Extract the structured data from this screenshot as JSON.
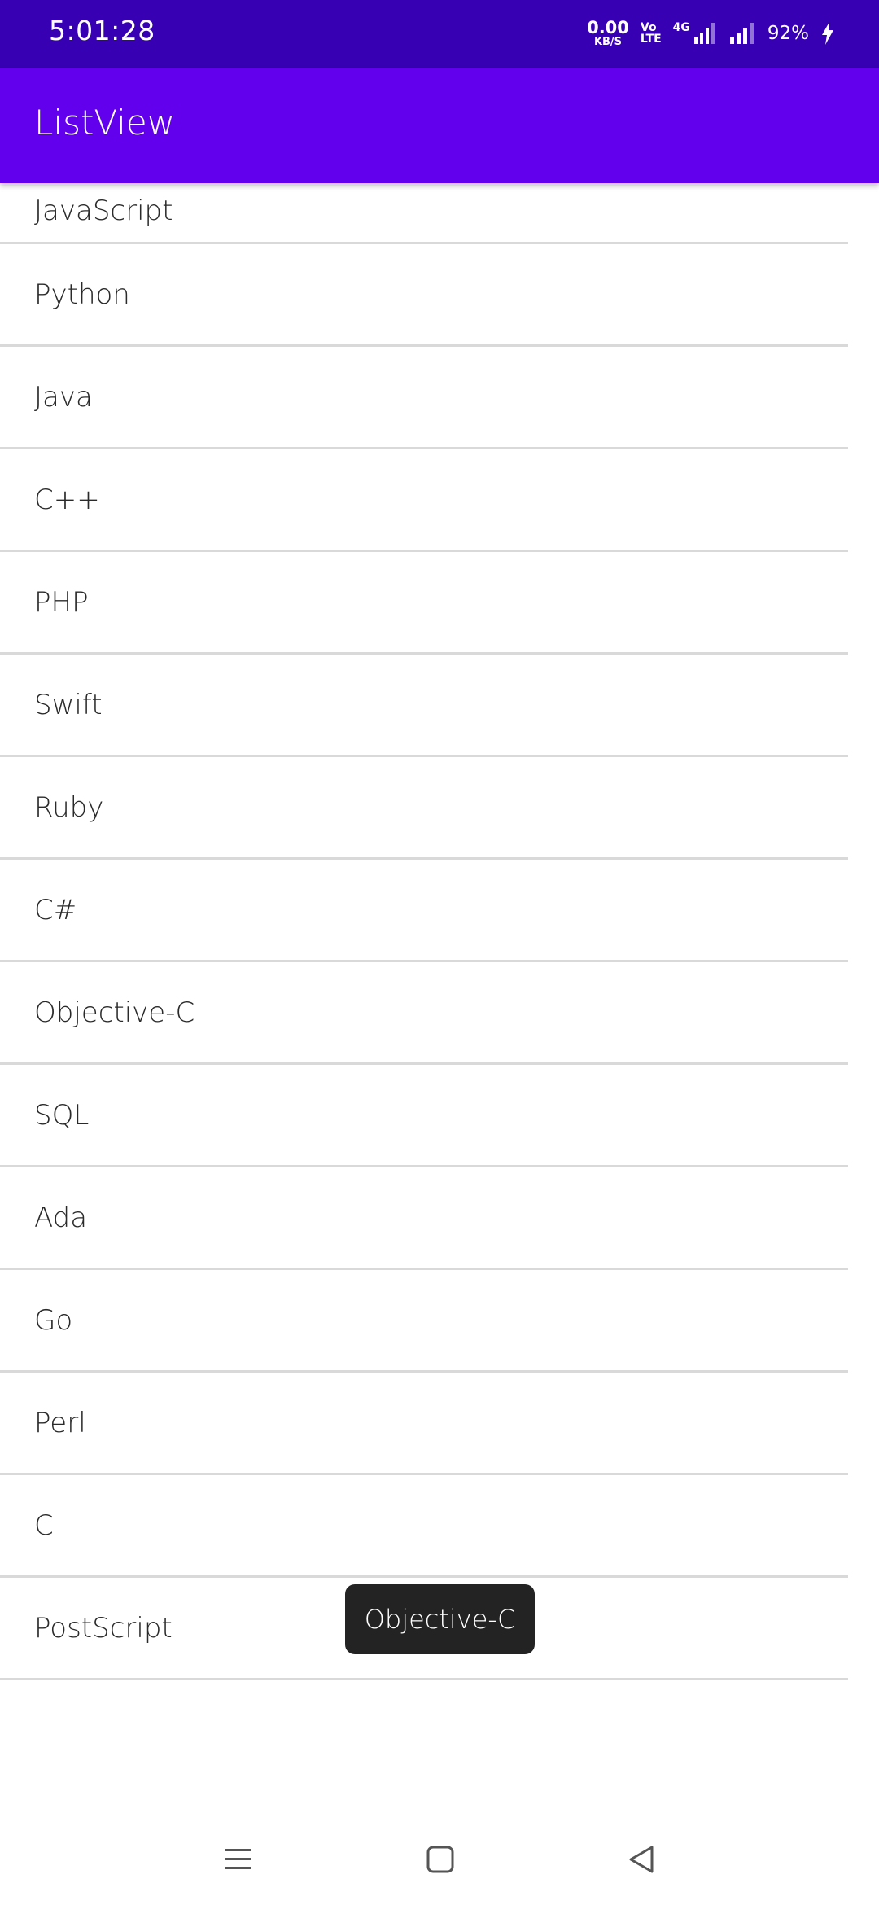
{
  "status_bar": {
    "time": "5:01:28",
    "speed_value": "0.00",
    "speed_unit": "KB/S",
    "volte_top": "Vo",
    "volte_bottom": "LTE",
    "network_type": "4G",
    "battery": "92%"
  },
  "app_bar": {
    "title": "ListView",
    "color": "#6200ee"
  },
  "list": {
    "items": [
      "JavaScript",
      "Python",
      "Java",
      "C++",
      "PHP",
      "Swift",
      "Ruby",
      "C#",
      "Objective-C",
      "SQL",
      "Ada",
      "Go",
      "Perl",
      "C",
      "PostScript"
    ]
  },
  "toast": {
    "text": "Objective-C"
  },
  "nav_bar": {
    "icons": [
      "menu-icon",
      "home-icon",
      "back-icon"
    ]
  }
}
